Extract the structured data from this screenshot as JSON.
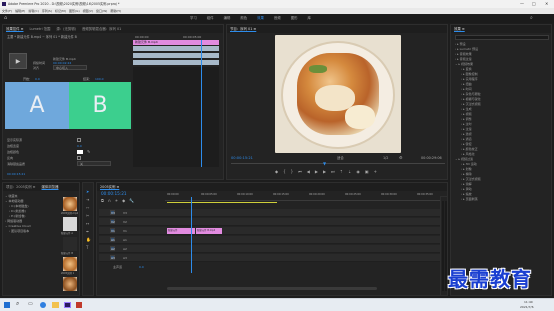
{
  "title_bar": {
    "title": "Adobe Premiere Pro 2020 - D:\\视频\\2020实例\\视频\\16\\2005实例.prproj *"
  },
  "menu": [
    "文件(F)",
    "编辑(E)",
    "剪辑(C)",
    "序列(S)",
    "标记(M)",
    "图形(G)",
    "视图(V)",
    "窗口(W)",
    "帮助(H)"
  ],
  "workspaces": [
    "学习",
    "组件",
    "编辑",
    "颜色",
    "效果",
    "音频",
    "图形",
    "库"
  ],
  "effect_controls": {
    "tabs": [
      "效果控件 ≡",
      "Lumetri 范围",
      "源：(无剪辑)",
      "音频剪辑混合器：序列 01"
    ],
    "source_line": "主要 * 新建元件 B.mp4 ~ 序列 01 * 新建元件 B",
    "clip_title": "新建元件 B.mp4",
    "mini_clip": "新建元件 B.mp4",
    "rows": [
      "过渡",
      "对齐",
      "显示实际源",
      "方向"
    ],
    "tc_left": "00:00:00",
    "tc_right": "00:00:05:00",
    "duration_label": "持续时间",
    "duration_value": "00:00:02:24",
    "align_value": "中心切入",
    "start_label": "开始：",
    "start_value": "0.0",
    "end_label": "结束：",
    "end_value": "100.0",
    "thumb_a": "A",
    "thumb_b": "B",
    "bottom_rows": [
      "显示实际源",
      "边框宽度",
      "边框颜色",
      "反向",
      "消除锯齿品质"
    ],
    "border_width": "0.0",
    "aa_value": "关",
    "timecode_bottom": "00:00:15:21"
  },
  "program": {
    "tab": "节目：序列 01 ≡",
    "timecode": "00:00:15:21",
    "fit": "适合",
    "page": "1/2",
    "duration": "00:00:29:06"
  },
  "project": {
    "tabs": [
      "项目：2005实例 ≡",
      "媒体浏览器"
    ],
    "tree": [
      "收藏夹",
      "本地驱动器",
      "C:(本地磁盘)",
      "D:(新加卷)",
      "E:(新加卷)",
      "网络驱动器",
      "Creative Cloud",
      "团队项目版本"
    ],
    "thumb_labels": [
      "2005实例.mp4",
      "新建元件 A",
      "新建元件 B",
      "2005实例 1"
    ]
  },
  "timeline": {
    "tab": "2005实例 ≡",
    "timecode": "00:00:15:21",
    "ruler": [
      "00:00:00",
      "00:00:05:00",
      "00:00:10:00",
      "00:00:15:00",
      "00:00:20:00",
      "00:00:25:00",
      "00:00:30:00",
      "00:00:35:00"
    ],
    "tracks": [
      "V3",
      "V2",
      "V1",
      "A1",
      "A2",
      "A3"
    ],
    "master": "主声道",
    "master_val": "0.0",
    "clip_a": "新建元件",
    "clip_b": "新建元件 B.mp4"
  },
  "effects": {
    "tab": "效果 ≡",
    "items": [
      "预设",
      "Lumetri 预设",
      "音频效果",
      "音频过渡",
      "视频效果",
      "变换",
      "图像控制",
      "实用程序",
      "扭曲",
      "时间",
      "杂色与颗粒",
      "模糊与锐化",
      "沉浸式视频",
      "生成",
      "视频",
      "调整",
      "过时",
      "过渡",
      "透视",
      "通道",
      "键控",
      "颜色校正",
      "风格化",
      "视频过渡",
      "3D 运动",
      "划像",
      "擦除",
      "沉浸式视频",
      "溶解",
      "滑动",
      "缩放",
      "页面剥落"
    ]
  },
  "watermark": "最需教育",
  "taskbar": {
    "time": "11:40",
    "date": "2021/7/6"
  },
  "colors": {
    "accent": "#2d8ceb",
    "clip_pink": "#e28be0",
    "thumb_a": "#6fa8dc",
    "thumb_b": "#3ccf8e",
    "title_bg": "#f2f2f2"
  }
}
